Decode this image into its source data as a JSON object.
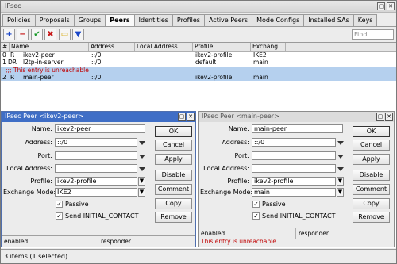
{
  "window": {
    "title": "IPsec"
  },
  "tabs": [
    "Policies",
    "Proposals",
    "Groups",
    "Peers",
    "Identities",
    "Profiles",
    "Active Peers",
    "Mode Configs",
    "Installed SAs",
    "Keys"
  ],
  "active_tab": "Peers",
  "toolbar": {
    "find_placeholder": "Find"
  },
  "table": {
    "columns": [
      "#",
      "Name",
      "Address",
      "Local Address",
      "Profile",
      "Exchang..."
    ],
    "rows": [
      {
        "num": "0",
        "flag": "R",
        "name": "ikev2-peer",
        "address": "::/0",
        "local_address": "",
        "profile": "ikev2-profile",
        "exchange": "IKE2"
      },
      {
        "num": "1",
        "flag": "DR",
        "name": "l2tp-in-server",
        "address": "::/0",
        "local_address": "",
        "profile": "default",
        "exchange": "main"
      },
      {
        "comment": ";;; This entry is unreachable"
      },
      {
        "num": "2",
        "flag": "R",
        "name": "main-peer",
        "address": "::/0",
        "local_address": "",
        "profile": "ikev2-profile",
        "exchange": "main"
      }
    ]
  },
  "status": {
    "items": "3 items (1 selected)"
  },
  "dialog1": {
    "title": "IPsec Peer <ikev2-peer>",
    "labels": {
      "name": "Name:",
      "address": "Address:",
      "port": "Port:",
      "local_address": "Local Address:",
      "profile": "Profile:",
      "exchange_mode": "Exchange Mode:"
    },
    "values": {
      "name": "ikev2-peer",
      "address": "::/0",
      "port": "",
      "local_address": "",
      "profile": "ikev2-profile",
      "exchange_mode": "IKE2"
    },
    "passive": "Passive",
    "send_initial": "Send INITIAL_CONTACT",
    "buttons": [
      "OK",
      "Cancel",
      "Apply",
      "Disable",
      "Comment",
      "Copy",
      "Remove"
    ],
    "status_left": "enabled",
    "status_right": "responder"
  },
  "dialog2": {
    "title": "IPsec Peer <main-peer>",
    "labels": {
      "name": "Name:",
      "address": "Address:",
      "port": "Port:",
      "local_address": "Local Address:",
      "profile": "Profile:",
      "exchange_mode": "Exchange Mode:"
    },
    "values": {
      "name": "main-peer",
      "address": "::/0",
      "port": "",
      "local_address": "",
      "profile": "ikev2-profile",
      "exchange_mode": "main"
    },
    "passive": "Passive",
    "send_initial": "Send INITIAL_CONTACT",
    "buttons": [
      "OK",
      "Cancel",
      "Apply",
      "Disable",
      "Comment",
      "Copy",
      "Remove"
    ],
    "status_left": "enabled",
    "status_right": "responder",
    "status_note": "This entry is unreachable"
  },
  "colors": {
    "selected_row": "#b5d0ee",
    "comment_text": "#c00000",
    "active_title": "#3f6ec6"
  }
}
